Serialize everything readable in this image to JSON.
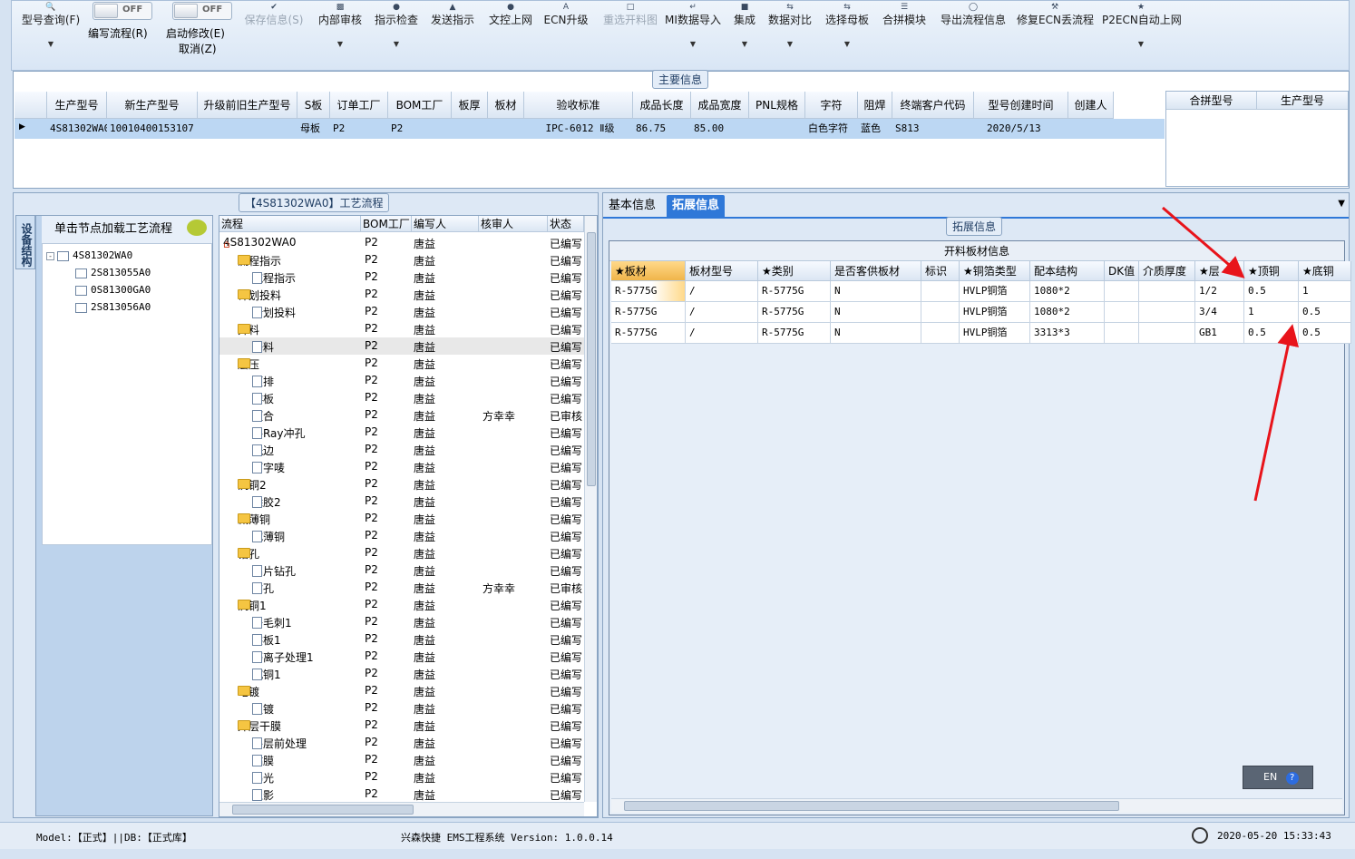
{
  "toolbar": {
    "buttons": [
      {
        "label": "型号查询(F)",
        "disabled": false
      },
      {
        "label": "编写流程(R)",
        "disabled": false
      },
      {
        "label": "启动修改(E)",
        "disabled": false
      },
      {
        "label": "取消(Z)",
        "disabled": false
      },
      {
        "label": "保存信息(S)",
        "disabled": true
      },
      {
        "label": "内部审核",
        "disabled": false
      },
      {
        "label": "指示检查",
        "disabled": false
      },
      {
        "label": "发送指示",
        "disabled": false
      },
      {
        "label": "文控上网",
        "disabled": false
      },
      {
        "label": "ECN升级",
        "disabled": false
      },
      {
        "label": "重选开料图",
        "disabled": true
      },
      {
        "label": "MI数据导入",
        "disabled": false
      },
      {
        "label": "集成",
        "disabled": false
      },
      {
        "label": "数据对比",
        "disabled": false
      },
      {
        "label": "选择母板",
        "disabled": false
      },
      {
        "label": "合拼模块",
        "disabled": false
      },
      {
        "label": "导出流程信息",
        "disabled": false
      },
      {
        "label": "修复ECN丢流程",
        "disabled": false
      },
      {
        "label": "P2ECN自动上网",
        "disabled": false
      }
    ],
    "switch1": "OFF",
    "switch2": "OFF"
  },
  "main_info": {
    "title": "主要信息",
    "columns": [
      "生产型号",
      "新生产型号",
      "升级前旧生产型号",
      "S板",
      "订单工厂",
      "BOM工厂",
      "板厚",
      "板材",
      "验收标准",
      "成品长度",
      "成品宽度",
      "PNL规格",
      "字符",
      "阻焊",
      "终端客户代码",
      "型号创建时间",
      "创建人"
    ],
    "row": [
      "4S81302WA0",
      "10010400153107",
      "",
      "母板",
      "P2",
      "P2",
      "",
      "",
      "IPC-6012 Ⅱ级",
      "86.75",
      "85.00",
      "",
      "白色字符",
      "蓝色",
      "S813",
      "2020/5/13",
      ""
    ],
    "merge_columns": [
      "合拼型号",
      "生产型号"
    ]
  },
  "flow_panel": {
    "title": "【4S81302WA0】工艺流程",
    "node_tab": "设备结构",
    "node_header": "单击节点加载工艺流程",
    "nodes": [
      "4S81302WA0",
      "2S813055A0",
      "0S81300GA0",
      "2S813056A0"
    ],
    "grid_columns": [
      "流程",
      "BOM工厂",
      "编写人",
      "核审人",
      "状态"
    ],
    "rows": [
      {
        "name": "4S81302WA0",
        "level": 0,
        "type": "root",
        "bom": "P2",
        "writer": "唐益",
        "reviewer": "",
        "status": "已编写"
      },
      {
        "name": "流程指示",
        "level": 1,
        "type": "folder",
        "bom": "P2",
        "writer": "唐益",
        "reviewer": "",
        "status": "已编写"
      },
      {
        "name": "流程指示",
        "level": 2,
        "type": "doc",
        "bom": "P2",
        "writer": "唐益",
        "reviewer": "",
        "status": "已编写"
      },
      {
        "name": "计划投料",
        "level": 1,
        "type": "folder",
        "bom": "P2",
        "writer": "唐益",
        "reviewer": "",
        "status": "已编写"
      },
      {
        "name": "计划投料",
        "level": 2,
        "type": "doc",
        "bom": "P2",
        "writer": "唐益",
        "reviewer": "",
        "status": "已编写"
      },
      {
        "name": "开料",
        "level": 1,
        "type": "folder",
        "bom": "P2",
        "writer": "唐益",
        "reviewer": "",
        "status": "已编写"
      },
      {
        "name": "开料",
        "level": 2,
        "type": "doc",
        "bom": "P2",
        "writer": "唐益",
        "reviewer": "",
        "status": "已编写"
      },
      {
        "name": "层压",
        "level": 1,
        "type": "folder",
        "bom": "P2",
        "writer": "唐益",
        "reviewer": "",
        "status": "已编写"
      },
      {
        "name": "预排",
        "level": 2,
        "type": "doc",
        "bom": "P2",
        "writer": "唐益",
        "reviewer": "",
        "status": "已编写"
      },
      {
        "name": "排板",
        "level": 2,
        "type": "doc",
        "bom": "P2",
        "writer": "唐益",
        "reviewer": "",
        "status": "已编写"
      },
      {
        "name": "压合",
        "level": 2,
        "type": "doc",
        "bom": "P2",
        "writer": "唐益",
        "reviewer": "方幸幸",
        "status": "已审核"
      },
      {
        "name": "X-Ray冲孔",
        "level": 2,
        "type": "doc",
        "bom": "P2",
        "writer": "唐益",
        "reviewer": "",
        "status": "已编写"
      },
      {
        "name": "铣边",
        "level": 2,
        "type": "doc",
        "bom": "P2",
        "writer": "唐益",
        "reviewer": "",
        "status": "已编写"
      },
      {
        "name": "打字唛",
        "level": 2,
        "type": "doc",
        "bom": "P2",
        "writer": "唐益",
        "reviewer": "",
        "status": "已编写"
      },
      {
        "name": "沉铜2",
        "level": 1,
        "type": "folder",
        "bom": "P2",
        "writer": "唐益",
        "reviewer": "",
        "status": "已编写"
      },
      {
        "name": "除胶2",
        "level": 2,
        "type": "doc",
        "bom": "P2",
        "writer": "唐益",
        "reviewer": "",
        "status": "已编写"
      },
      {
        "name": "减薄铜",
        "level": 1,
        "type": "folder",
        "bom": "P2",
        "writer": "唐益",
        "reviewer": "",
        "status": "已编写"
      },
      {
        "name": "减薄铜",
        "level": 2,
        "type": "doc",
        "bom": "P2",
        "writer": "唐益",
        "reviewer": "",
        "status": "已编写"
      },
      {
        "name": "钻孔",
        "level": 1,
        "type": "folder",
        "bom": "P2",
        "writer": "唐益",
        "reviewer": "",
        "status": "已编写"
      },
      {
        "name": "铝片钻孔",
        "level": 2,
        "type": "doc",
        "bom": "P2",
        "writer": "唐益",
        "reviewer": "",
        "status": "已编写"
      },
      {
        "name": "钻孔",
        "level": 2,
        "type": "doc",
        "bom": "P2",
        "writer": "唐益",
        "reviewer": "方幸幸",
        "status": "已审核"
      },
      {
        "name": "沉铜1",
        "level": 1,
        "type": "folder",
        "bom": "P2",
        "writer": "唐益",
        "reviewer": "",
        "status": "已编写"
      },
      {
        "name": "去毛刺1",
        "level": 2,
        "type": "doc",
        "bom": "P2",
        "writer": "唐益",
        "reviewer": "",
        "status": "已编写"
      },
      {
        "name": "烘板1",
        "level": 2,
        "type": "doc",
        "bom": "P2",
        "writer": "唐益",
        "reviewer": "",
        "status": "已编写"
      },
      {
        "name": "等离子处理1",
        "level": 2,
        "type": "doc",
        "bom": "P2",
        "writer": "唐益",
        "reviewer": "",
        "status": "已编写"
      },
      {
        "name": "沉铜1",
        "level": 2,
        "type": "doc",
        "bom": "P2",
        "writer": "唐益",
        "reviewer": "",
        "status": "已编写"
      },
      {
        "name": "电镀",
        "level": 1,
        "type": "folder",
        "bom": "P2",
        "writer": "唐益",
        "reviewer": "",
        "status": "已编写"
      },
      {
        "name": "板镀",
        "level": 2,
        "type": "doc",
        "bom": "P2",
        "writer": "唐益",
        "reviewer": "",
        "status": "已编写"
      },
      {
        "name": "外层干膜",
        "level": 1,
        "type": "folder",
        "bom": "P2",
        "writer": "唐益",
        "reviewer": "",
        "status": "已编写"
      },
      {
        "name": "外层前处理",
        "level": 2,
        "type": "doc",
        "bom": "P2",
        "writer": "唐益",
        "reviewer": "",
        "status": "已编写"
      },
      {
        "name": "贴膜",
        "level": 2,
        "type": "doc",
        "bom": "P2",
        "writer": "唐益",
        "reviewer": "",
        "status": "已编写"
      },
      {
        "name": "曝光",
        "level": 2,
        "type": "doc",
        "bom": "P2",
        "writer": "唐益",
        "reviewer": "",
        "status": "已编写"
      },
      {
        "name": "显影",
        "level": 2,
        "type": "doc",
        "bom": "P2",
        "writer": "唐益",
        "reviewer": "",
        "status": "已编写"
      }
    ]
  },
  "detail_panel": {
    "tabs": [
      "基本信息",
      "拓展信息"
    ],
    "active_tab": "拓展信息",
    "section_title": "拓展信息",
    "sheet_title": "开料板材信息",
    "columns": [
      "★板材",
      "板材型号",
      "★类别",
      "是否客供板材",
      "标识",
      "★铜箔类型",
      "配本结构",
      "DK值",
      "介质厚度",
      "★层",
      "★顶铜",
      "★底铜"
    ],
    "rows": [
      [
        "R-5775G",
        "/",
        "R-5775G",
        "N",
        "",
        "HVLP铜箔",
        "1080*2",
        "",
        "",
        "1/2",
        "0.5",
        "1"
      ],
      [
        "R-5775G",
        "/",
        "R-5775G",
        "N",
        "",
        "HVLP铜箔",
        "1080*2",
        "",
        "",
        "3/4",
        "1",
        "0.5"
      ],
      [
        "R-5775G",
        "/",
        "R-5775G",
        "N",
        "",
        "HVLP铜箔",
        "3313*3",
        "",
        "",
        "GB1",
        "0.5",
        "0.5"
      ]
    ],
    "ime_label": "EN"
  },
  "statusbar": {
    "left": "Model:【正式】||DB:【正式库】",
    "center": "兴森快捷 EMS工程系统 Version: 1.0.0.14",
    "datetime": "2020-05-20 15:33:43"
  },
  "colors": {
    "accent": "#2f78d8",
    "annotation_arrow": "#e8141b",
    "selected_row": "#bcd7f3"
  }
}
